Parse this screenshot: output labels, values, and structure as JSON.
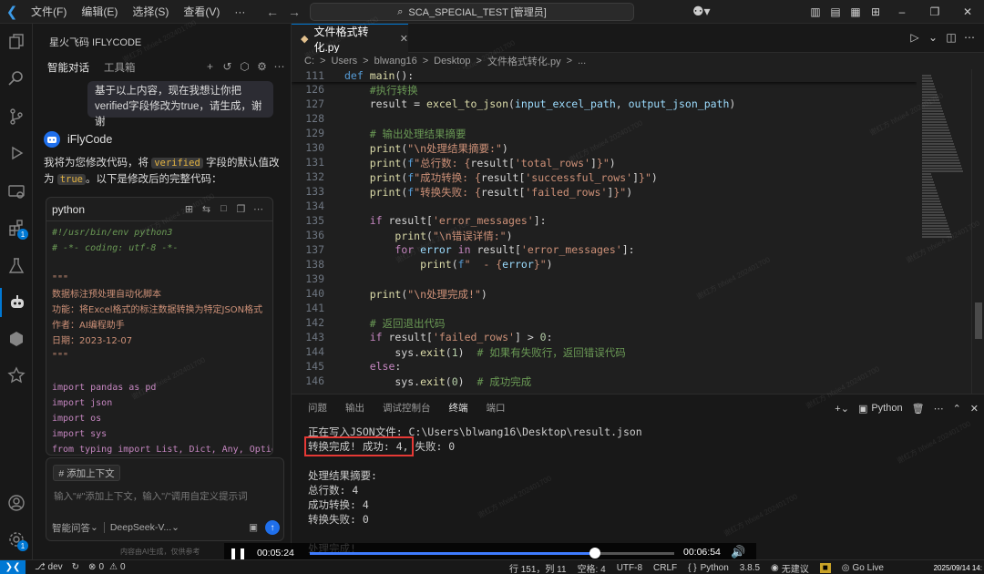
{
  "titlebar": {
    "menus": [
      "文件(F)",
      "编辑(E)",
      "选择(S)",
      "查看(V)"
    ],
    "more": "···",
    "command_center": "SCA_SPECIAL_TEST [管理员]"
  },
  "activity_badges": {
    "extensions": "1",
    "accounts": "1"
  },
  "side_panel": {
    "title": "星火飞码 IFLYCODE",
    "tabs": [
      "智能对话",
      "工具箱"
    ],
    "user_message": "基于以上内容，现在我想让你把verified字段修改为true，请生成，谢谢",
    "ai_name": "iFlyCode",
    "ai_intro_1": "我将为您修改代码，将",
    "ai_intro_code_1": "verified",
    "ai_intro_2": "字段的默认值改",
    "ai_intro_3": "为",
    "ai_intro_code_2": "true",
    "ai_intro_4": "。以下是修改后的完整代码：",
    "code_lang": "python",
    "code_lines": [
      {
        "cls": "c-com",
        "t": "#!/usr/bin/env python3"
      },
      {
        "cls": "c-com",
        "t": "# -*- coding: utf-8 -*-"
      },
      {
        "cls": "c-plain",
        "t": ""
      },
      {
        "cls": "c-str",
        "t": "\"\"\""
      },
      {
        "cls": "c-cjk",
        "t": "数据标注预处理自动化脚本"
      },
      {
        "cls": "c-cjk",
        "t": "功能：将Excel格式的标注数据转换为特定JSON格式"
      },
      {
        "cls": "c-cjk",
        "t": "作者：AI编程助手"
      },
      {
        "cls": "c-cjk",
        "t": "日期：2023-12-07"
      },
      {
        "cls": "c-str",
        "t": "\"\"\""
      },
      {
        "cls": "c-plain",
        "t": ""
      },
      {
        "cls": "c-kw",
        "t": "import pandas as pd"
      },
      {
        "cls": "c-kw",
        "t": "import json"
      },
      {
        "cls": "c-kw",
        "t": "import os"
      },
      {
        "cls": "c-kw",
        "t": "import sys"
      },
      {
        "cls": "c-kw",
        "t": "from typing import List, Dict, Any, Optional"
      }
    ],
    "context_button": "# 添加上下文",
    "input_placeholder": "输入\"#\"添加上下文，输入\"/\"调用自定义提示词",
    "mode": "智能问答",
    "model": "DeepSeek-V...",
    "notice": "内容由AI生成，仅供参考"
  },
  "editor": {
    "tab_label": "文件格式转化.py",
    "breadcrumb": [
      "C:",
      ">",
      "Users",
      ">",
      "blwang16",
      ">",
      "Desktop",
      ">",
      "文件格式转化.py",
      ">",
      "..."
    ],
    "sticky_line": "111",
    "sticky_code": "def main():",
    "line_numbers": [
      "126",
      "127",
      "128",
      "129",
      "130",
      "131",
      "132",
      "133",
      "134",
      "135",
      "136",
      "137",
      "138",
      "139",
      "140",
      "141",
      "142",
      "143",
      "144",
      "145",
      "146"
    ]
  },
  "terminal": {
    "tabs": [
      "问题",
      "输出",
      "调试控制台",
      "终端",
      "端口"
    ],
    "active_tab": "终端",
    "shell": "Python",
    "lines": [
      "正在写入JSON文件: C:\\Users\\blwang16\\Desktop\\result.json",
      "转换完成! 成功: 4, 失败: 0",
      "",
      "处理结果摘要:",
      "总行数: 4",
      "成功转换: 4",
      "转换失败: 0",
      "",
      "处理完成!"
    ]
  },
  "video": {
    "current_time": "00:05:24",
    "total_time": "00:06:54",
    "progress": 0.783
  },
  "statusbar": {
    "branch": "dev",
    "errors": "0",
    "warnings": "0",
    "position": "行 151，列 11",
    "spaces": "空格: 4",
    "encoding": "UTF-8",
    "eol": "CRLF",
    "language": "Python",
    "python_version": "3.8.5",
    "no_suggestion": "无建议",
    "golive": "Go Live",
    "timestamp": "2025/09/14 14:"
  },
  "watermark_text": "谢红方 hfxie4 202401700"
}
